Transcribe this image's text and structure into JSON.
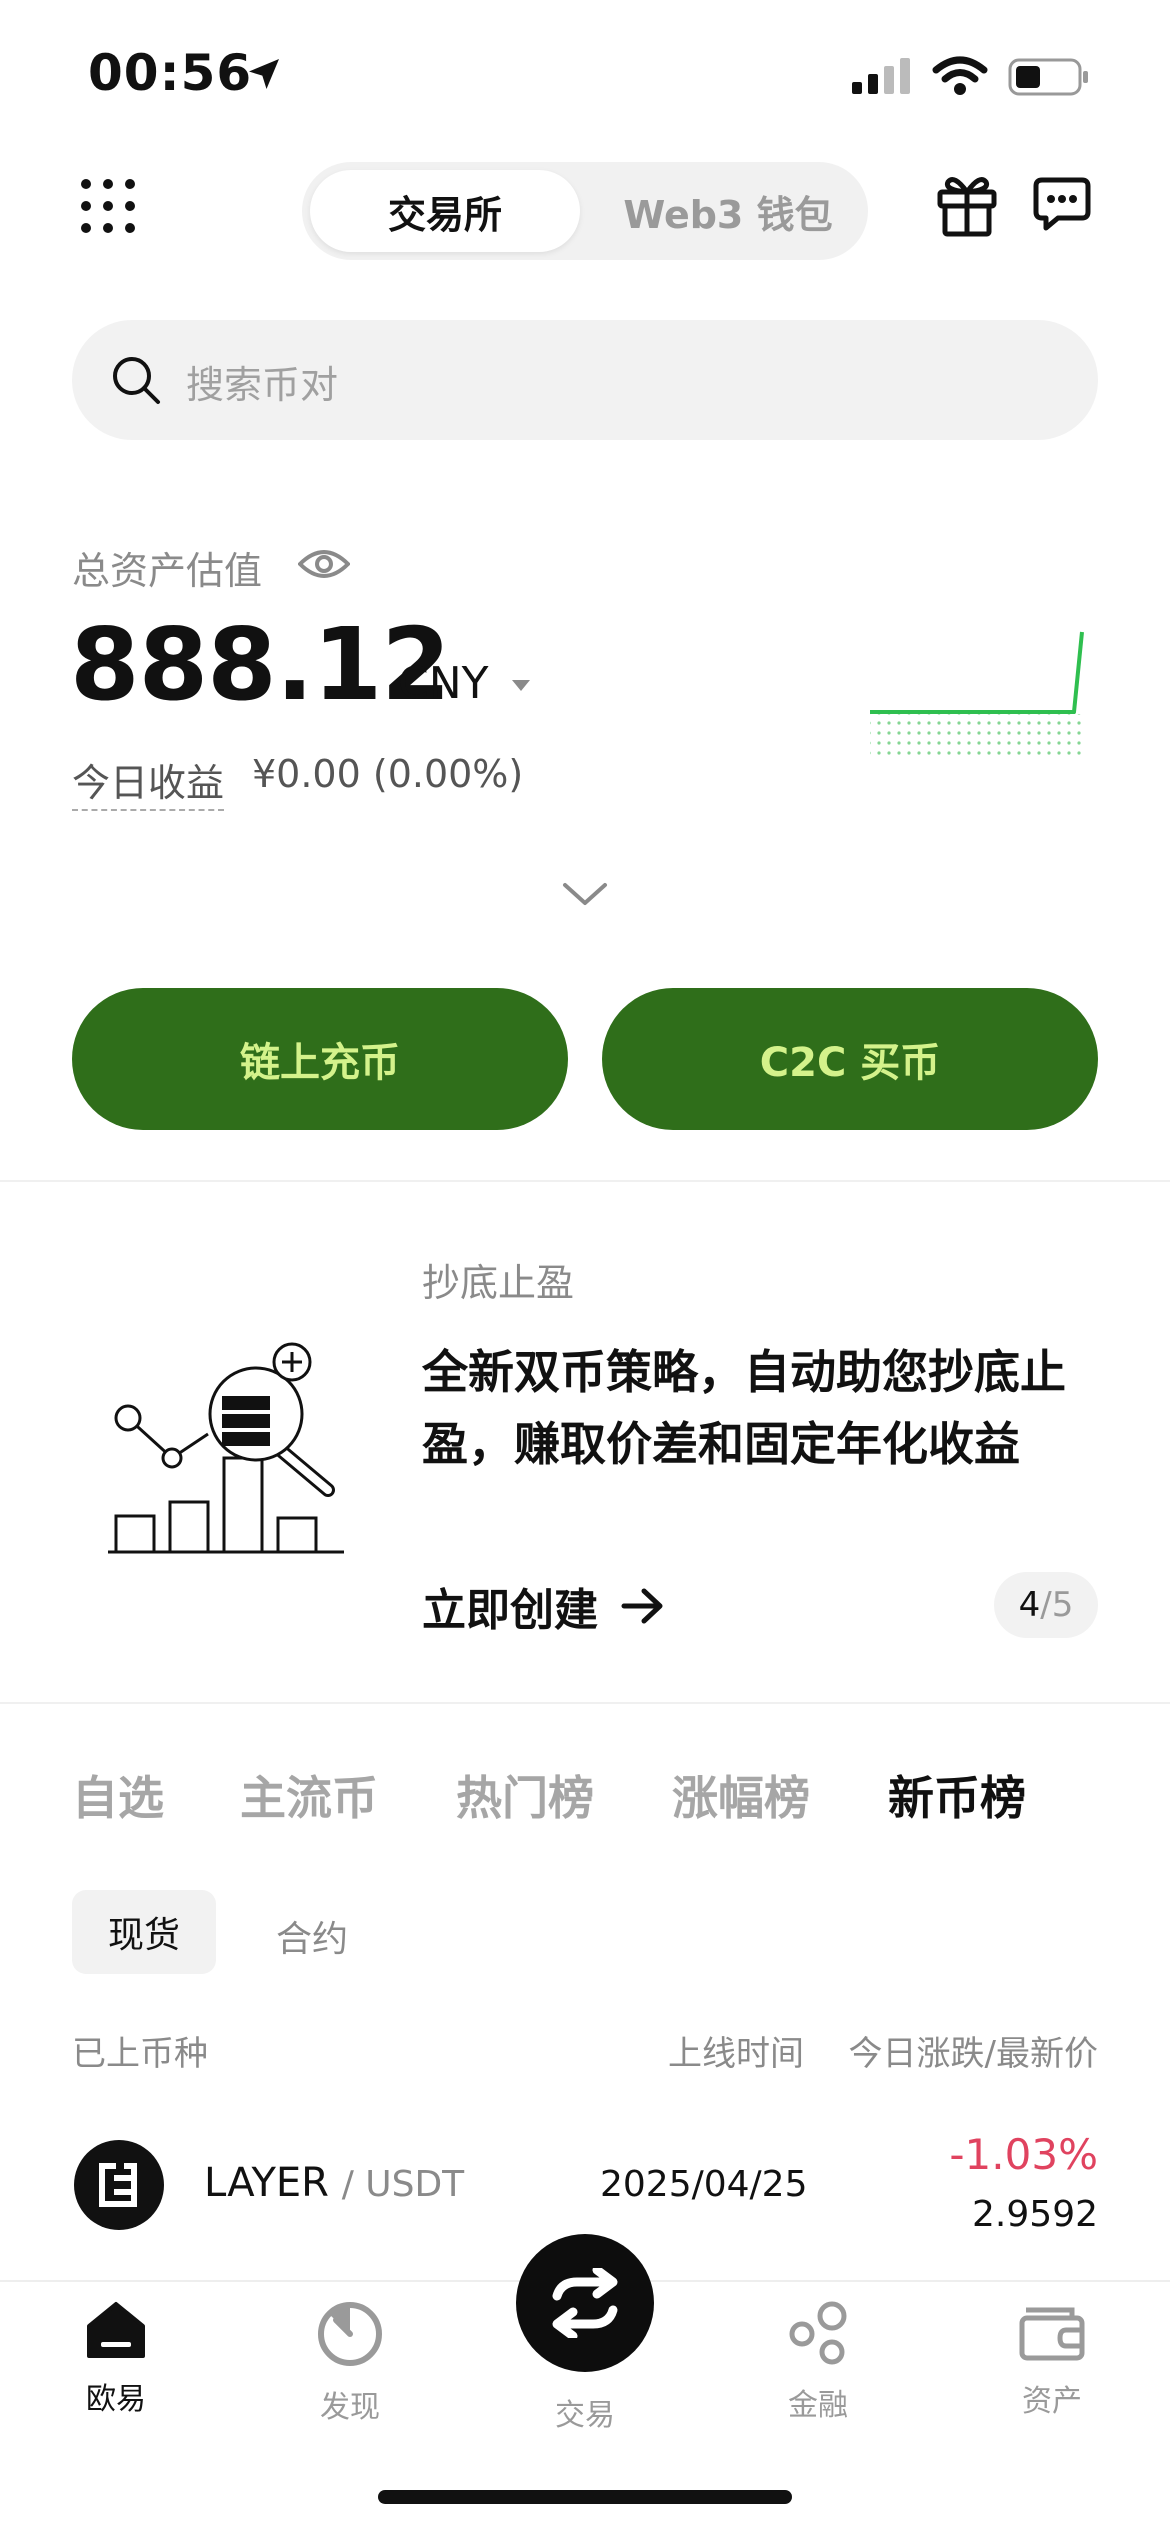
{
  "status_bar": {
    "time": "00:56"
  },
  "header": {
    "segments": [
      {
        "label": "交易所",
        "active": true
      },
      {
        "label": "Web3 钱包",
        "active": false
      }
    ]
  },
  "search": {
    "placeholder": "搜索币对"
  },
  "assets": {
    "label": "总资产估值",
    "value": "888.12",
    "currency": "CNY",
    "today_label": "今日收益",
    "today_value": "¥0.00 (0.00%)"
  },
  "actions": {
    "deposit": "链上充币",
    "buy": "C2C 买币"
  },
  "promo": {
    "tag": "抄底止盈",
    "title": "全新双币策略，自动助您抄底止盈，赚取价差和固定年化收益",
    "cta": "立即创建",
    "page_current": "4",
    "page_total": "/5"
  },
  "market_tabs": [
    "自选",
    "主流币",
    "热门榜",
    "涨幅榜",
    "新币榜"
  ],
  "market_tab_active": "新币榜",
  "sub_tabs": [
    "现货",
    "合约"
  ],
  "columns": {
    "listed": "已上币种",
    "time": "上线时间",
    "change_price": "今日涨跌/最新价"
  },
  "rows": [
    {
      "base": "LAYER",
      "quote": "/ USDT",
      "date": "2025/04/25",
      "change": "-1.03%",
      "price": "2.9592"
    }
  ],
  "bottom_nav": {
    "home": "欧易",
    "discover": "发现",
    "trade": "交易",
    "finance": "金融",
    "assets": "资产"
  },
  "colors": {
    "brand_green": "#2f6e1a",
    "button_text": "#d4f28b",
    "negative": "#e0435f",
    "spark": "#2fbf4f"
  }
}
